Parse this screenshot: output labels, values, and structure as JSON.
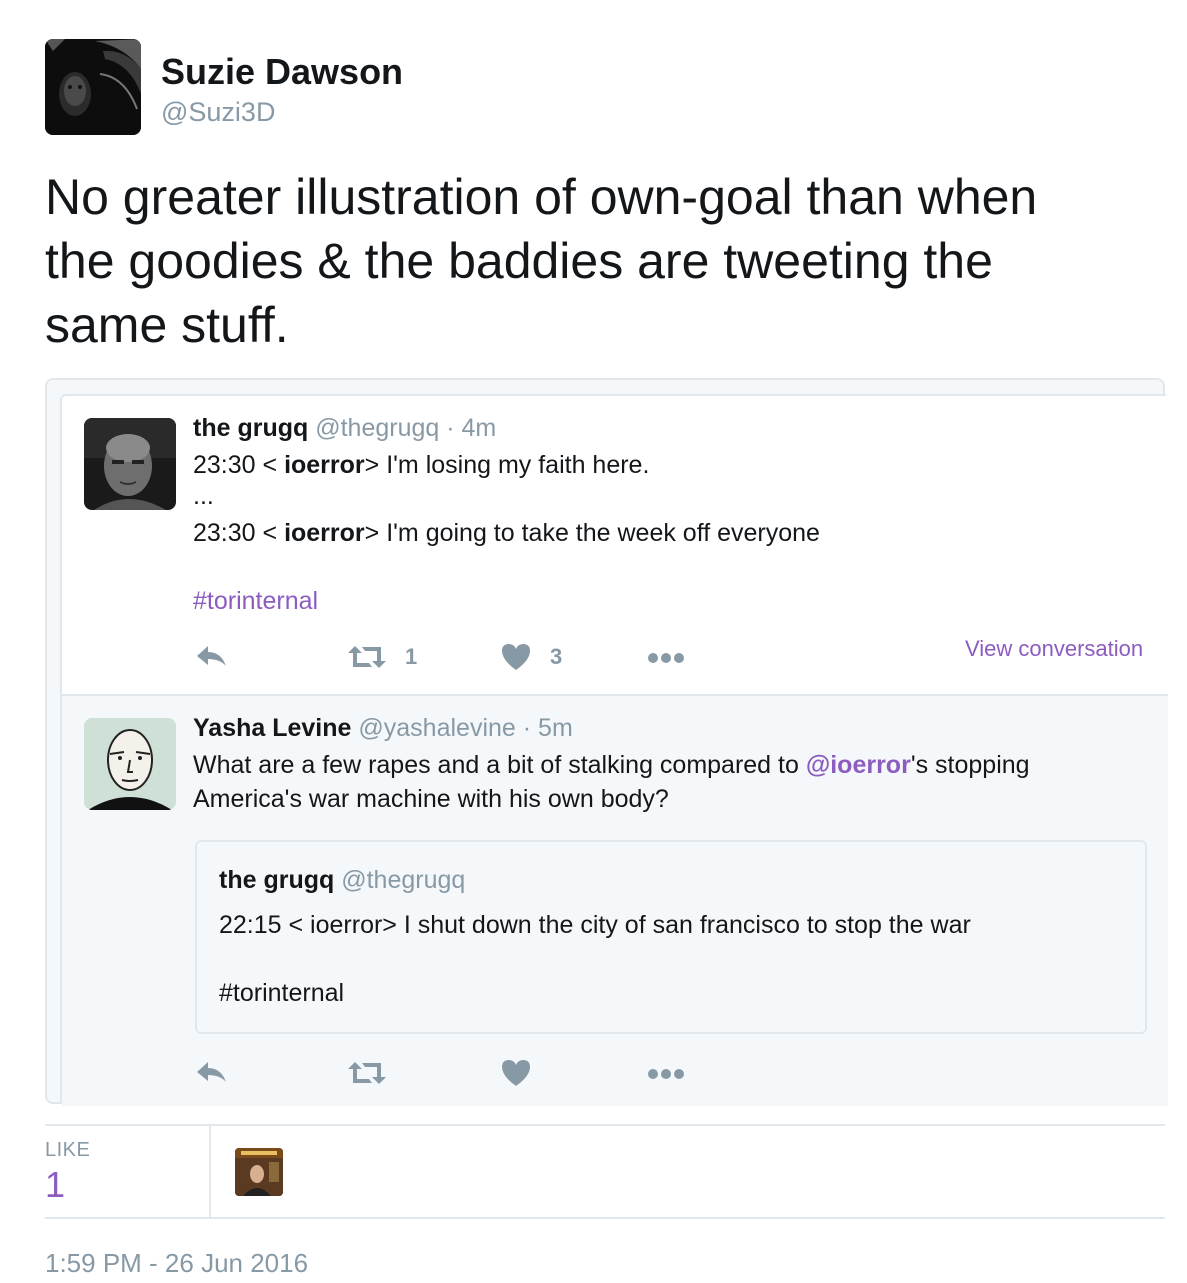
{
  "author": {
    "name": "Suzie Dawson",
    "handle": "@Suzi3D",
    "avatar_icon": "profile-photo"
  },
  "tweet": {
    "text": "No greater illustration of own-goal than when\nthe goodies & the baddies are tweeting the\nsame stuff."
  },
  "embedded": [
    {
      "name": "the grugq",
      "handle": "@thegrugq",
      "separator": "·",
      "time": "4m",
      "line1": {
        "prefix": "23:30 < ",
        "nick": "ioerror",
        "suffix": "> I'm losing my faith here."
      },
      "ellipsis": "...",
      "line2": {
        "prefix": "23:30 < ",
        "nick": "ioerror",
        "suffix": "> I'm going to take the week off everyone"
      },
      "hashtag": "#torinternal",
      "retweet_count": "1",
      "like_count": "3",
      "view_conversation": "View conversation"
    },
    {
      "name": "Yasha Levine",
      "handle": "@yashalevine",
      "separator": "·",
      "time": "5m",
      "text_before": "What are a few rapes and a bit of stalking compared to ",
      "mention": "@ioerror",
      "text_after": "'s stopping",
      "text_line2": "America's war machine with his own body?",
      "quote": {
        "name": "the grugq",
        "handle": "@thegrugq",
        "line": "22:15 < ioerror> I shut down the city of san francisco to stop the war",
        "hashtag": "#torinternal"
      }
    }
  ],
  "stats": {
    "like_label": "LIKE",
    "like_count": "1"
  },
  "timestamp": "1:59 PM - 26 Jun 2016",
  "colors": {
    "link": "#8c5cbf",
    "muted": "#8899a6",
    "border": "#e1e8ed",
    "text": "#14171a"
  }
}
